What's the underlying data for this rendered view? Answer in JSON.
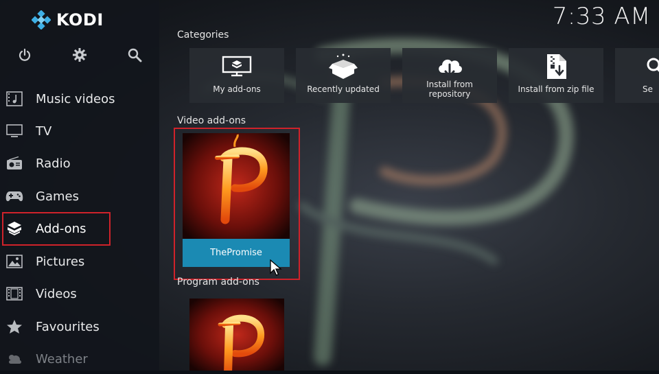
{
  "app": {
    "name": "KODI",
    "clock": "7:33 AM"
  },
  "toolbar": {
    "icons": [
      "power-icon",
      "gear-icon",
      "search-icon"
    ]
  },
  "sidebar": {
    "items": [
      {
        "label": "Music videos",
        "icon": "music-video-icon"
      },
      {
        "label": "TV",
        "icon": "tv-icon"
      },
      {
        "label": "Radio",
        "icon": "radio-icon"
      },
      {
        "label": "Games",
        "icon": "gamepad-icon"
      },
      {
        "label": "Add-ons",
        "icon": "addon-box-icon",
        "highlighted": true
      },
      {
        "label": "Pictures",
        "icon": "picture-icon"
      },
      {
        "label": "Videos",
        "icon": "film-icon"
      },
      {
        "label": "Favourites",
        "icon": "star-icon"
      },
      {
        "label": "Weather",
        "icon": "weather-icon",
        "dimmed": true
      }
    ]
  },
  "main": {
    "categories_label": "Categories",
    "categories": [
      {
        "label": "My add-ons",
        "icon": "monitor-box-icon"
      },
      {
        "label": "Recently updated",
        "icon": "open-box-icon"
      },
      {
        "label": "Install from\nrepository",
        "icon": "cloud-download-icon"
      },
      {
        "label": "Install from zip file",
        "icon": "zip-file-icon"
      },
      {
        "label": "Se",
        "icon": "search-icon"
      }
    ],
    "video_addons_label": "Video add-ons",
    "video_addons": [
      {
        "title": "ThePromise",
        "selected": true
      }
    ],
    "program_addons_label": "Program add-ons"
  },
  "colors": {
    "accent": "#1b8ab3",
    "highlight": "#d0222a",
    "sidebar": "#12161c"
  }
}
